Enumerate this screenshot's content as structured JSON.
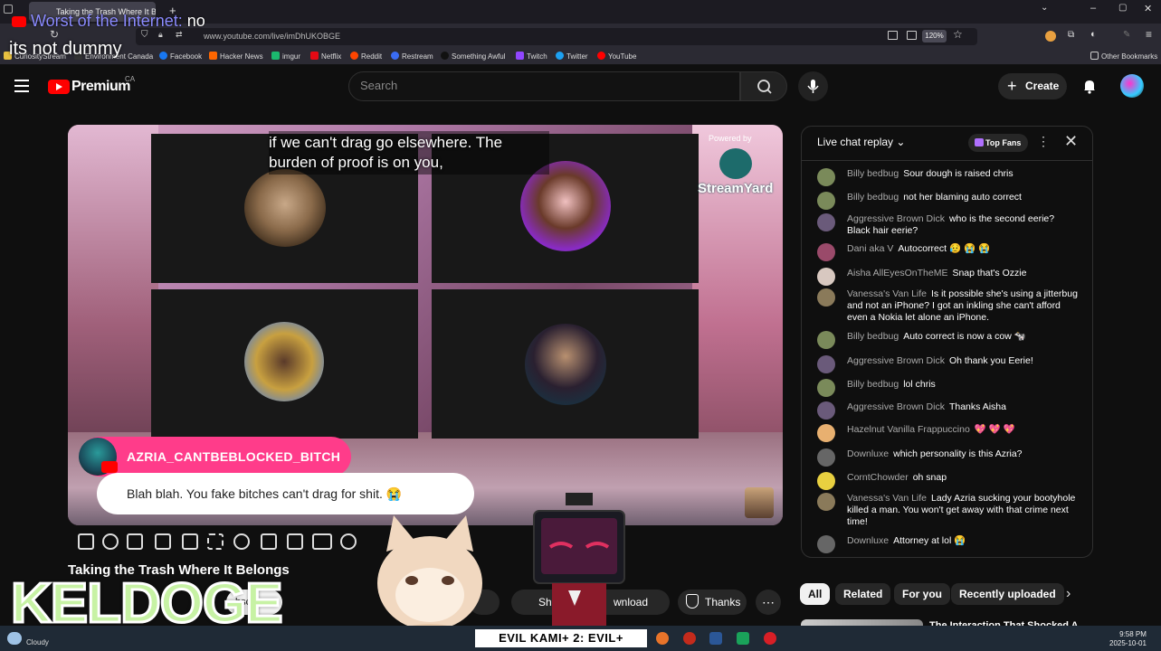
{
  "browser": {
    "tab_title": "Taking the Trash Where It B...",
    "url": "www.youtube.com/live/imDhUKOBGE",
    "zoom": "120%",
    "bookmarks": [
      "CuriosityStream",
      "Environment Canada",
      "Facebook",
      "Hacker News",
      "imgur",
      "Netflix",
      "Reddit",
      "Restream",
      "Something Awful",
      "Twitch",
      "Twitter",
      "YouTube"
    ],
    "other_bookmarks": "Other Bookmarks"
  },
  "overlay": {
    "author": "Worst of the Internet:",
    "line1": "no",
    "line2": "its not dummy"
  },
  "youtube": {
    "brand": "Premium",
    "region": "CA",
    "search_placeholder": "Search",
    "create": "Create"
  },
  "video": {
    "caption": "if we can't drag go elsewhere. The burden of proof is on you,",
    "powered_by": "Powered by",
    "streamyard": "StreamYard",
    "commenter": "AZRIA_CANTBEBLOCKED_BITCH",
    "comment": "Blah blah. You fake bitches can't drag for shit. 😭",
    "title": "Taking the Trash Where It Belongs"
  },
  "actions": {
    "subscribe": "bscribe",
    "share": "Sha",
    "download": "wnload",
    "thanks": "Thanks"
  },
  "stream_overlay": {
    "keldoge": "KELDOGE",
    "ticker": "EVIL KAMI+ 2: EVIL+"
  },
  "chat": {
    "title": "Live chat replay",
    "top_fans": "Top Fans",
    "messages": [
      {
        "author": "Billy bedbug",
        "text": "Sour dough is raised chris",
        "color": "#7a8a5a"
      },
      {
        "author": "Billy bedbug",
        "text": "not her blaming auto correct",
        "color": "#7a8a5a"
      },
      {
        "author": "Aggressive Brown Dick",
        "text": "who is the second eerie? Black hair eerie?",
        "color": "#6a5a7a"
      },
      {
        "author": "Dani aka V",
        "text": "Autocorrect 😥 😭 😭",
        "color": "#9a4a6a"
      },
      {
        "author": "Aisha AllEyesOnTheME",
        "text": "Snap that's Ozzie",
        "color": "#d8c8c0"
      },
      {
        "author": "Vanessa's Van Life",
        "text": "Is it possible she's using a jitterbug and not an iPhone? I got an inkling she can't afford even a Nokia let alone an iPhone.",
        "color": "#8a7a5a"
      },
      {
        "author": "Billy bedbug",
        "text": "Auto correct is now a cow 🐄",
        "color": "#7a8a5a"
      },
      {
        "author": "Aggressive Brown Dick",
        "text": "Oh thank you Eerie!",
        "color": "#6a5a7a"
      },
      {
        "author": "Billy bedbug",
        "text": "lol chris",
        "color": "#7a8a5a"
      },
      {
        "author": "Aggressive Brown Dick",
        "text": "Thanks Aisha",
        "color": "#6a5a7a"
      },
      {
        "author": "Hazelnut Vanilla Frappuccino",
        "text": "💖 💖 💖",
        "color": "#e8b070"
      },
      {
        "author": "Downluxe",
        "text": "which personality is this Azria?",
        "color": "#666666"
      },
      {
        "author": "CorntChowder",
        "text": "oh snap",
        "color": "#e8d040"
      },
      {
        "author": "Vanessa's Van Life",
        "text": "Lady Azria sucking your bootyhole killed a man. You won't get away with that crime next time!",
        "color": "#8a7a5a"
      },
      {
        "author": "Downluxe",
        "text": "Attorney at lol 😭",
        "color": "#666666"
      }
    ]
  },
  "chips": [
    "All",
    "Related",
    "For you",
    "Recently uploaded"
  ],
  "related_title": "The Interaction That Shocked A",
  "taskbar": {
    "weather": "Cloudy",
    "time": "9:58 PM",
    "date": "2025-10-01"
  }
}
